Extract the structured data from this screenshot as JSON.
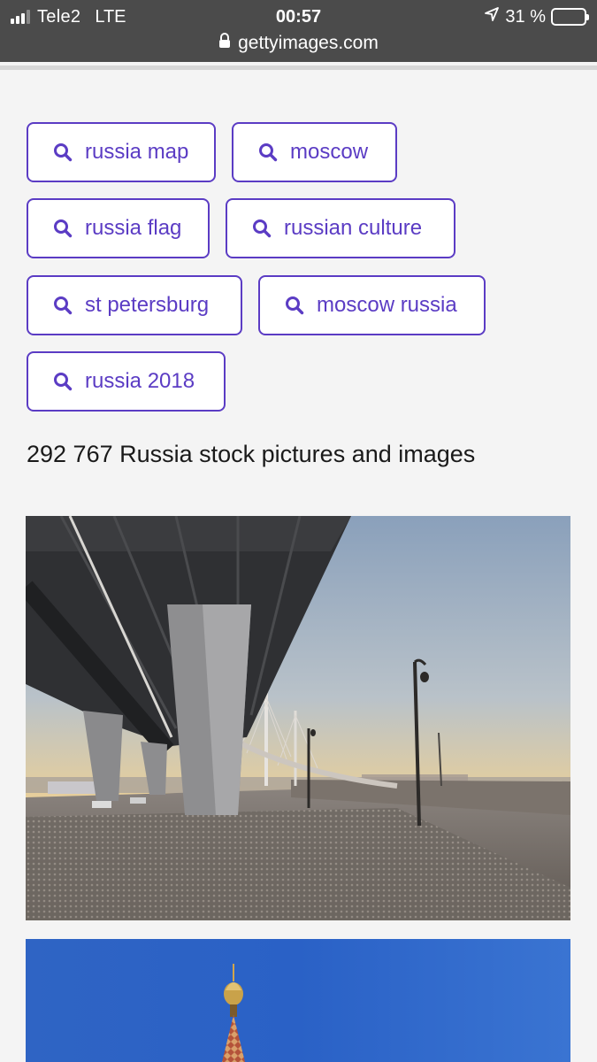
{
  "status_bar": {
    "carrier": "Tele2",
    "network": "LTE",
    "time": "00:57",
    "battery_text": "31 %",
    "battery_level": 0.31,
    "battery_color": "#f5d033"
  },
  "address_bar": {
    "url": "gettyimages.com",
    "lock_icon": "lock-icon"
  },
  "related_searches": [
    {
      "label": "russia map",
      "icon": "search-icon"
    },
    {
      "label": "moscow",
      "icon": "search-icon"
    },
    {
      "label": "russia flag",
      "icon": "search-icon"
    },
    {
      "label": "russian culture",
      "icon": "search-icon"
    },
    {
      "label": "st petersburg",
      "icon": "search-icon"
    },
    {
      "label": "moscow russia",
      "icon": "search-icon"
    },
    {
      "label": "russia 2018",
      "icon": "search-icon"
    }
  ],
  "results": {
    "title": "292 767 Russia stock pictures and images"
  },
  "colors": {
    "accent": "#5b3cc4",
    "background": "#f4f4f4",
    "topbar": "#4b4b4b"
  }
}
